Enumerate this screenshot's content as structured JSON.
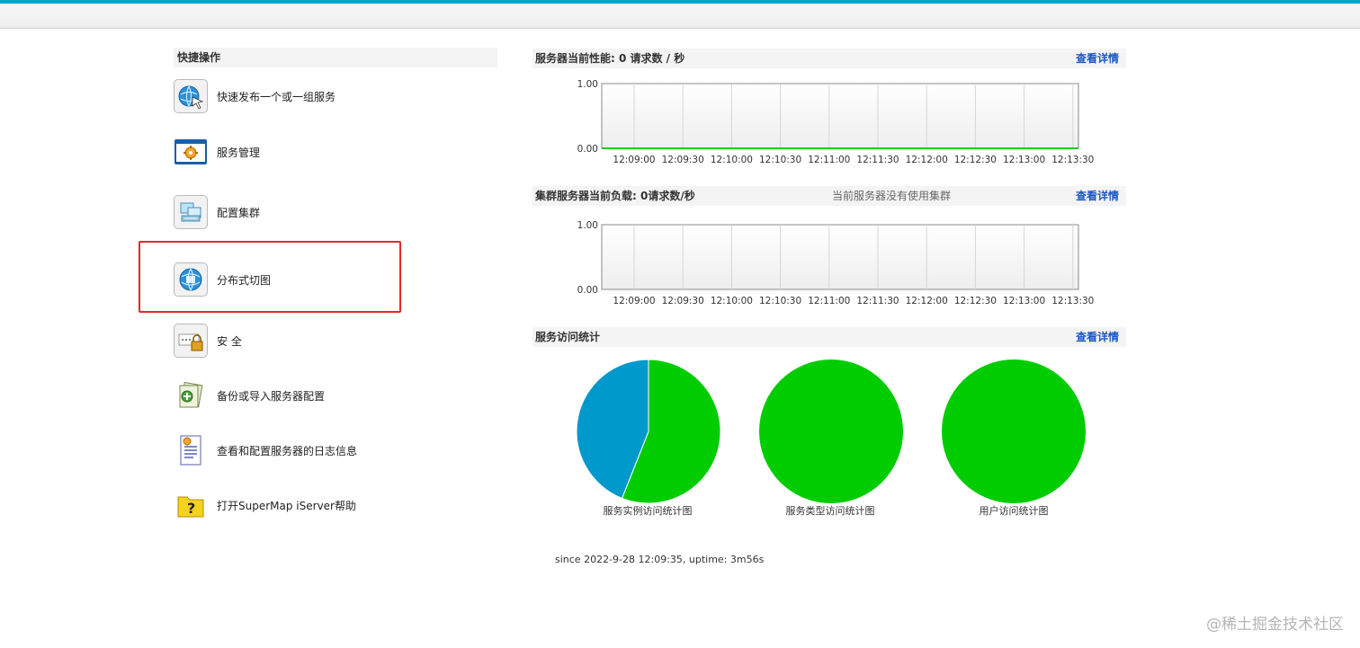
{
  "quick": {
    "title": "快捷操作",
    "items": [
      {
        "label": "快速发布一个或一组服务",
        "icon": "publish-service-icon"
      },
      {
        "label": "服务管理",
        "icon": "service-management-icon"
      },
      {
        "label": "配置集群",
        "icon": "cluster-config-icon"
      },
      {
        "label": "分布式切图",
        "icon": "distributed-tiling-icon"
      },
      {
        "label": "安 全",
        "icon": "security-lock-icon"
      },
      {
        "label": "备份或导入服务器配置",
        "icon": "backup-import-icon"
      },
      {
        "label": "查看和配置服务器的日志信息",
        "icon": "log-document-icon"
      },
      {
        "label": "打开SuperMap iServer帮助",
        "icon": "help-question-icon"
      }
    ]
  },
  "perf": {
    "title": "服务器当前性能:   0 请求数 / 秒",
    "link": "查看详情"
  },
  "cluster": {
    "title": "集群服务器当前负载:  0请求数/秒",
    "note": "当前服务器没有使用集群",
    "link": "查看详情"
  },
  "stats": {
    "title": "服务访问统计",
    "link": "查看详情",
    "pie_labels": [
      "服务实例访问统计图",
      "服务类型访问统计图",
      "用户访问统计图"
    ]
  },
  "footer": {
    "since": "since 2022-9-28 12:09:35, uptime: 3m56s"
  },
  "watermark": "@稀土掘金技术社区",
  "colors": {
    "accent_bar": "#11a2c8",
    "link": "#1a56c5",
    "highlight": "#e8262c",
    "series_line": "#22cc22",
    "pie_green": "#00cc00",
    "pie_blue": "#0099cc"
  },
  "chart_data": [
    {
      "type": "line",
      "x": [
        "12:09:00",
        "12:09:30",
        "12:10:00",
        "12:10:30",
        "12:11:00",
        "12:11:30",
        "12:12:00",
        "12:12:30",
        "12:13:00",
        "12:13:30"
      ],
      "yticks": [
        "1.00",
        "0.00"
      ],
      "ylim": [
        0,
        1
      ],
      "series": [
        {
          "values": [
            0,
            0,
            0,
            0,
            0,
            0,
            0,
            0,
            0,
            0
          ]
        }
      ]
    },
    {
      "type": "line",
      "x": [
        "12:09:00",
        "12:09:30",
        "12:10:00",
        "12:10:30",
        "12:11:00",
        "12:11:30",
        "12:12:00",
        "12:12:30",
        "12:13:00",
        "12:13:30"
      ],
      "yticks": [
        "1.00",
        "0.00"
      ],
      "ylim": [
        0,
        1
      ],
      "series": []
    },
    {
      "type": "pie",
      "title": "服务实例访问统计图",
      "slices": [
        {
          "value": 56,
          "color": "#00cc00"
        },
        {
          "value": 44,
          "color": "#0099cc"
        }
      ]
    },
    {
      "type": "pie",
      "title": "服务类型访问统计图",
      "slices": [
        {
          "value": 100,
          "color": "#00cc00"
        }
      ]
    },
    {
      "type": "pie",
      "title": "用户访问统计图",
      "slices": [
        {
          "value": 100,
          "color": "#00cc00"
        }
      ]
    }
  ]
}
